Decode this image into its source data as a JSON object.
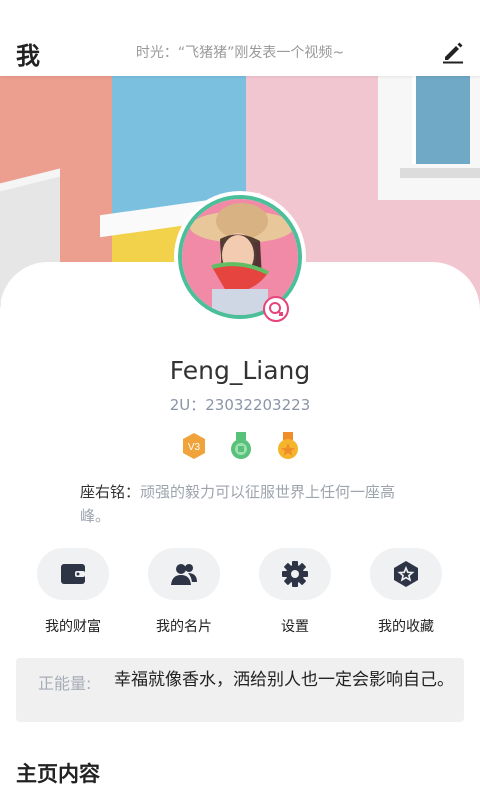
{
  "header": {
    "title": "我",
    "subtitle": "时光：“飞猪猪”刚发表一个视频~",
    "edit_icon": "edit-icon"
  },
  "profile": {
    "username": "Feng_Liang",
    "uid": "2U：23032203223",
    "badges": [
      {
        "name": "v3-badge",
        "text": "V3",
        "color": "#f0a33b"
      },
      {
        "name": "green-medal-icon",
        "color": "#58c17a"
      },
      {
        "name": "gold-medal-icon",
        "color": "#f5b42a"
      }
    ],
    "motto_label": "座右铭：",
    "motto_text": "顽强的毅力可以征服世界上任何一座高峰。"
  },
  "actions": [
    {
      "label": "我的财富",
      "icon": "wallet-icon"
    },
    {
      "label": "我的名片",
      "icon": "contacts-icon"
    },
    {
      "label": "设置",
      "icon": "gear-icon"
    },
    {
      "label": "我的收藏",
      "icon": "favorite-hexagon-icon"
    }
  ],
  "energy": {
    "label": "正能量:",
    "text": "幸福就像香水，洒给别人也一定会影响自己。"
  },
  "section": {
    "title": "主页内容"
  },
  "colors": {
    "accent_ring": "#4bbf9a",
    "gender_pink": "#e6457a",
    "icon_dark": "#2d3446"
  }
}
